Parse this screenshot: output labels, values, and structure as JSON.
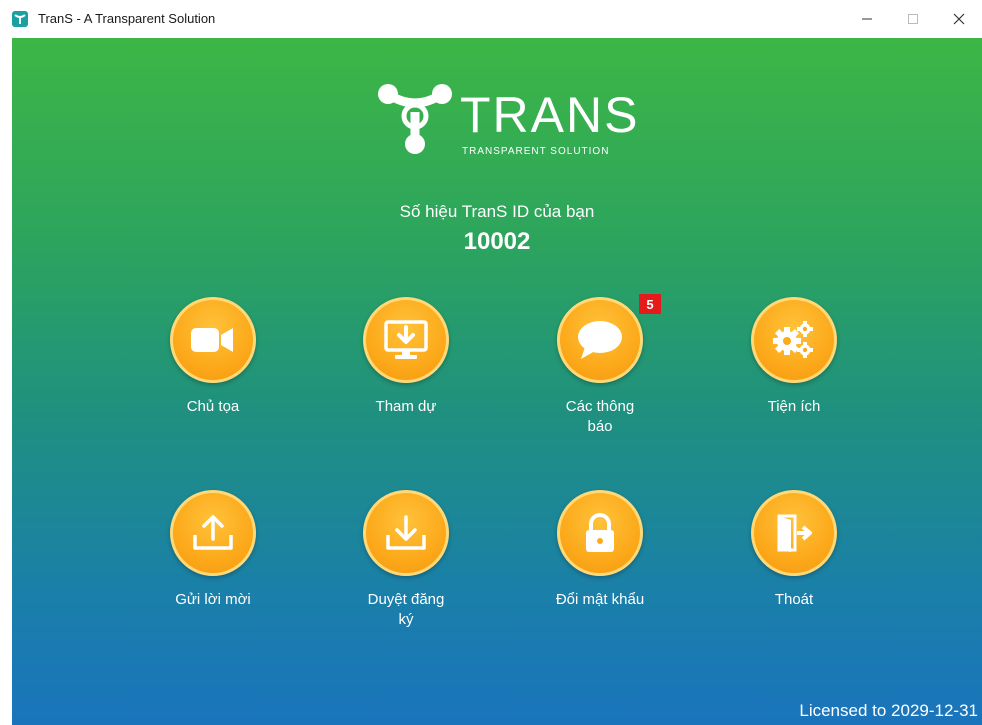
{
  "window": {
    "title": "TranS - A Transparent Solution",
    "minimize_icon": "minimize-icon",
    "maximize_icon": "maximize-icon",
    "close_icon": "close-icon"
  },
  "logo": {
    "wordmark": "TRANS",
    "tagline": "TRANSPARENT SOLUTION"
  },
  "id_panel": {
    "caption": "Số hiệu TranS ID của bạn",
    "value": "10002"
  },
  "tiles": [
    {
      "label": "Chủ tọa",
      "icon": "video-camera-icon"
    },
    {
      "label": "Tham dự",
      "icon": "monitor-download-icon"
    },
    {
      "label": "Các thông báo",
      "icon": "chat-bubble-icon",
      "badge": "5"
    },
    {
      "label": "Tiện ích",
      "icon": "gears-icon"
    },
    {
      "label": "Gửi lời mời",
      "icon": "upload-icon"
    },
    {
      "label": "Duyệt đăng ký",
      "icon": "download-icon"
    },
    {
      "label": "Đổi mật khẩu",
      "icon": "lock-icon"
    },
    {
      "label": "Thoát",
      "icon": "exit-door-icon"
    }
  ],
  "license": "Licensed to 2029-12-31",
  "colors": {
    "gradient_top": "#3db646",
    "gradient_bottom": "#1a74bc",
    "tile_orange": "#fca91a",
    "badge_red": "#e51b1b"
  }
}
